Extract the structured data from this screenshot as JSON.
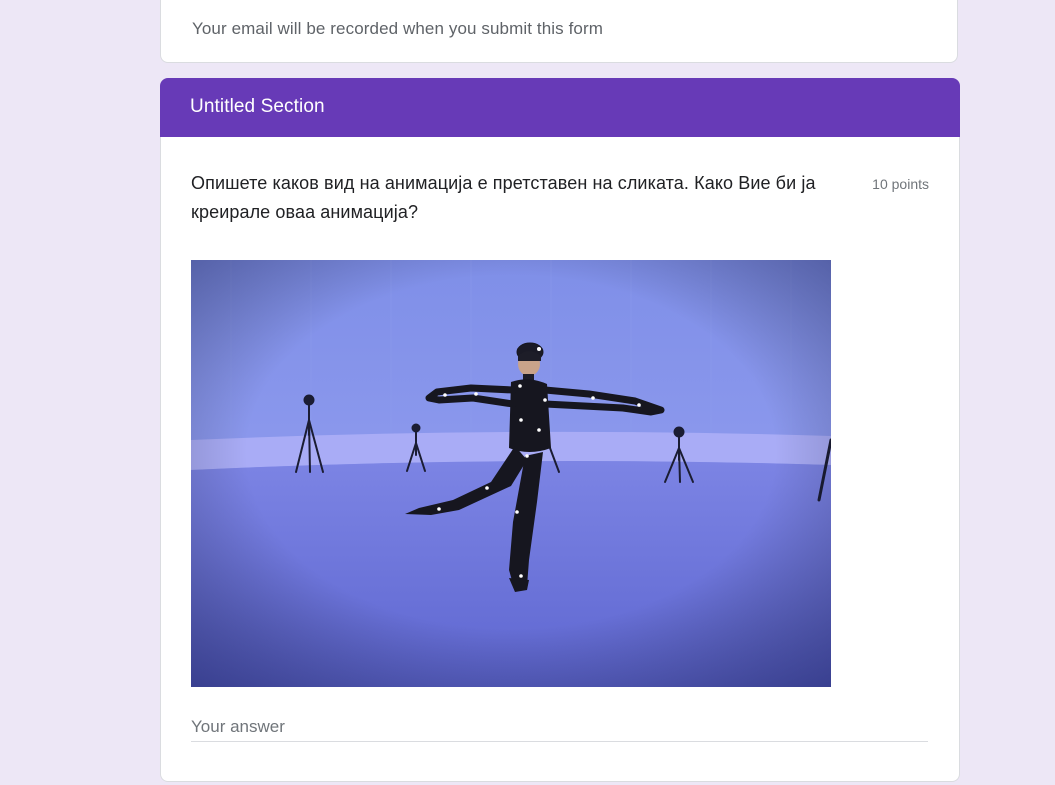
{
  "email_card": {
    "notice": "Your email will be recorded when you submit this form"
  },
  "section": {
    "title": "Untitled Section",
    "accent_color": "#673ab7"
  },
  "question": {
    "title": "Опишете каков вид на анимација е претставен на сликата. Како Вие би ја креирале оваа анимација?",
    "points": "10 points",
    "answer_value": "",
    "answer_placeholder": "Your answer"
  },
  "colors": {
    "page_background": "#ede7f6",
    "card_background": "#ffffff",
    "text_primary": "#202124",
    "text_secondary": "#5f6368"
  }
}
